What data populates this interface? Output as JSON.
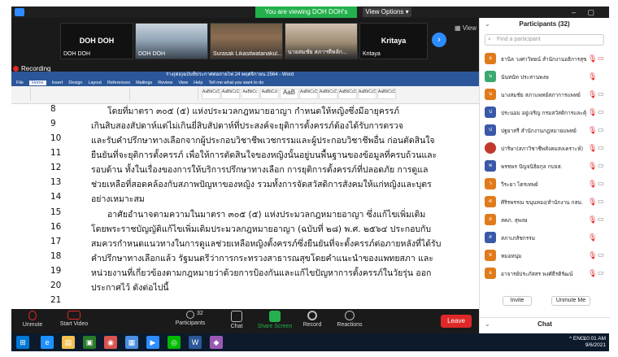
{
  "zoom": {
    "banner": "You are viewing DOH DOH's screen",
    "view_options": "View Options ▾",
    "window_controls": "– ▢ ✕",
    "view_btn": "▦ View",
    "recording": "Recording",
    "gallery": [
      {
        "name": "DOH DOH",
        "label": "DOH DOH",
        "style": "dark"
      },
      {
        "name": "",
        "label": "DOH DOH",
        "style": "photo2"
      },
      {
        "name": "",
        "label": "Surasak Likasitwatanakul...",
        "style": "photo"
      },
      {
        "name": "",
        "label": "นายสมชัย สภาฯทีหลัก...",
        "style": "photo3"
      },
      {
        "name": "Kritaya",
        "label": "Kritaya",
        "style": "dark"
      }
    ],
    "toolbar": {
      "unmute": "Unmute",
      "start_video": "Start Video",
      "participants": "Participants",
      "participants_count": "32",
      "chat": "Chat",
      "share_screen": "Share Screen",
      "record": "Record",
      "reactions": "Reactions",
      "leave": "Leave"
    }
  },
  "word": {
    "title": "ร่าง(ต่อ)ฉบับที่ประกาศต่อถ่ายไฟ 24 พฤศจิกายน 2564 - Word",
    "tabs": [
      "File",
      "Home",
      "Insert",
      "Design",
      "Layout",
      "References",
      "Mailings",
      "Review",
      "View",
      "Help",
      "Tell me what you want to do"
    ],
    "styles": [
      "AaBbCcDd",
      "AaBbCcDd",
      "AaBbCc",
      "AaBbCcl",
      "AaB",
      "AaBbCcD",
      "AaBbCcDd",
      "AaBbCcDd",
      "AaBbCcDd",
      "AaBbCcDd"
    ],
    "lines": [
      {
        "num": "8",
        "text": "โดยที่มาตรา ๓๐๕ (๕) แห่งประมวลกฎหมายอาญา กำหนดให้หญิงซึ่งมีอายุครรภ์",
        "indent": true
      },
      {
        "num": "9",
        "text": "เกินสิบสองสัปดาห์แต่ไม่เกินยี่สิบสัปดาห์ที่ประสงค์จะยุติการตั้งครรภ์ต้องได้รับการตรวจ",
        "indent": false
      },
      {
        "num": "10",
        "text": "และรับคำปรึกษาทางเลือกจากผู้ประกอบวิชาชีพเวชกรรมและผู้ประกอบวิชาชีพอื่น ก่อนตัดสินใจ",
        "indent": false
      },
      {
        "num": "11",
        "text": "ยืนยันที่จะยุติการตั้งครรภ์ เพื่อให้การตัดสินใจของหญิงนั้นอยู่บนพื้นฐานของข้อมูลที่ครบถ้วนและ",
        "indent": false
      },
      {
        "num": "12",
        "text": "รอบด้าน ทั้งในเรื่องของการให้บริการปรึกษาทางเลือก การยุติการตั้งครรภ์ที่ปลอดภัย การดูแล",
        "indent": false
      },
      {
        "num": "13",
        "text": "ช่วยเหลือที่สอดคล้องกับสภาพปัญหาของหญิง รวมทั้งการจัดสวัสดิการสังคมให้แก่หญิงและบุตร",
        "indent": false
      },
      {
        "num": "14",
        "text": "อย่างเหมาะสม",
        "indent": false
      },
      {
        "num": "15",
        "text": "อาศัยอำนาจตามความในมาตรา ๓๐๕ (๕) แห่งประมวลกฎหมายอาญา ซึ่งแก้ไขเพิ่มเติม",
        "indent": true
      },
      {
        "num": "16",
        "text": "โดยพระราชบัญญัติแก้ไขเพิ่มเติมประมวลกฎหมายอาญา (ฉบับที่ ๒๘) พ.ศ. ๒๕๖๔ ประกอบกับ",
        "indent": false
      },
      {
        "num": "17",
        "text": "สมควรกำหนดแนวทางในการดูแลช่วยเหลือหญิงตั้งครรภ์ซึ่งยืนยันที่จะตั้งครรภ์ต่อภายหลังที่ได้รับ",
        "indent": false
      },
      {
        "num": "18",
        "text": "คำปรึกษาทางเลือกแล้ว รัฐมนตรีว่าการกระทรวงสาธารณสุขโดยคำแนะนำของแพทยสภา และ",
        "indent": false
      },
      {
        "num": "19",
        "text": "หน่วยงานที่เกี่ยวข้องตามกฎหมายว่าด้วยการป้องกันและแก้ไขปัญหาการตั้งครรภ์ในวัยรุ่น ออก",
        "indent": false
      },
      {
        "num": "20",
        "text": "ประกาศไว้ ดังต่อไปนี้",
        "indent": false
      },
      {
        "num": "21",
        "text": "",
        "indent": false
      }
    ]
  },
  "participants": {
    "header": "Participants (32)",
    "search_placeholder": "Find a participant",
    "invite": "Invite",
    "unmute_me": "Unmute Me",
    "list": [
      {
        "initial": "อ",
        "name": "ธานิล วงศาวิทยน์ สำนักงานอธิการสุขสุข",
        "color": "#e07b1c",
        "cam_on": false
      },
      {
        "initial": "น",
        "name": "นันทนัท ประสานพงษ",
        "color": "#3aa86f",
        "cam_on": false
      },
      {
        "initial": "น",
        "name": "นางสมชัย สภาแพทย์สภาการแพทย์",
        "color": "#e07b1c",
        "cam_on": true
      },
      {
        "initial": "ป",
        "name": "ประนอม อยู่เจริญ กรมสวัสดิการและคุ้ม...",
        "color": "#3a58a8",
        "cam_on": true
      },
      {
        "initial": "ป",
        "name": "ปฐยาสรี สำนักงานกฎหมายแพทย์",
        "color": "#3a58a8",
        "cam_on": true
      },
      {
        "initial": "",
        "name": "ปาริษา(สภาวิชาชีพสังคมสงเคราะห์)",
        "color": "#c0392b",
        "cam_on": true
      },
      {
        "initial": "พ",
        "name": "พรชพร ปัญจนิธิยกุล กบจส.",
        "color": "#3a58a8",
        "cam_on": true
      },
      {
        "initial": "ว",
        "name": "วีระยา ไตรเทพย์",
        "color": "#e07b1c",
        "cam_on": true
      },
      {
        "initial": "ศ",
        "name": "ศิริรพรรณ ขนุนทอง/สำนักงาน กสม.",
        "color": "#e07b1c",
        "cam_on": true
      },
      {
        "initial": "ส",
        "name": "สคภ. สุพงษ",
        "color": "#e07b1c",
        "cam_on": true
      },
      {
        "initial": "ส",
        "name": "สภาเภสัชกรรม",
        "color": "#3a58a8",
        "cam_on": false
      },
      {
        "initial": "ห",
        "name": "หมอหนุ่ม",
        "color": "#e07b1c",
        "cam_on": true
      },
      {
        "initial": "อ",
        "name": "อาจารย์ประภัสสร พงศ์ธีรติรัฒน์",
        "color": "#e07b1c",
        "cam_on": false
      }
    ]
  },
  "chat": {
    "header": "Chat"
  },
  "taskbar": {
    "tray": "^  ENG",
    "time": "10:01 AM",
    "date": "9/6/2021"
  }
}
